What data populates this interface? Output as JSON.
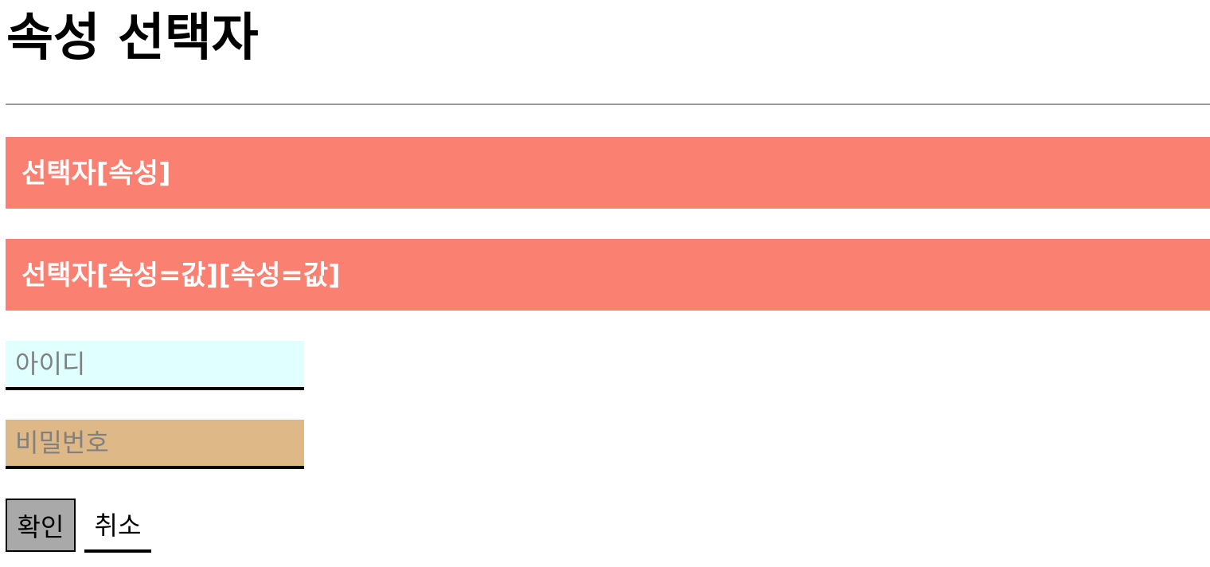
{
  "page": {
    "title": "속성 선택자"
  },
  "banners": [
    {
      "text": "선택자[속성]",
      "background": "#fa8072",
      "color": "#ffffff"
    },
    {
      "text": "선택자[속성=값][속성=값]",
      "background": "#fa8072",
      "color": "#ffffff"
    }
  ],
  "form": {
    "id_field": {
      "placeholder": "아이디",
      "value": "",
      "background": "#e0ffff"
    },
    "password_field": {
      "placeholder": "비밀번호",
      "value": "",
      "background": "#deb887"
    },
    "confirm_button": {
      "label": "확인",
      "background": "#a9a9a9"
    },
    "cancel_button": {
      "label": "취소",
      "background": "#ffffff"
    }
  }
}
